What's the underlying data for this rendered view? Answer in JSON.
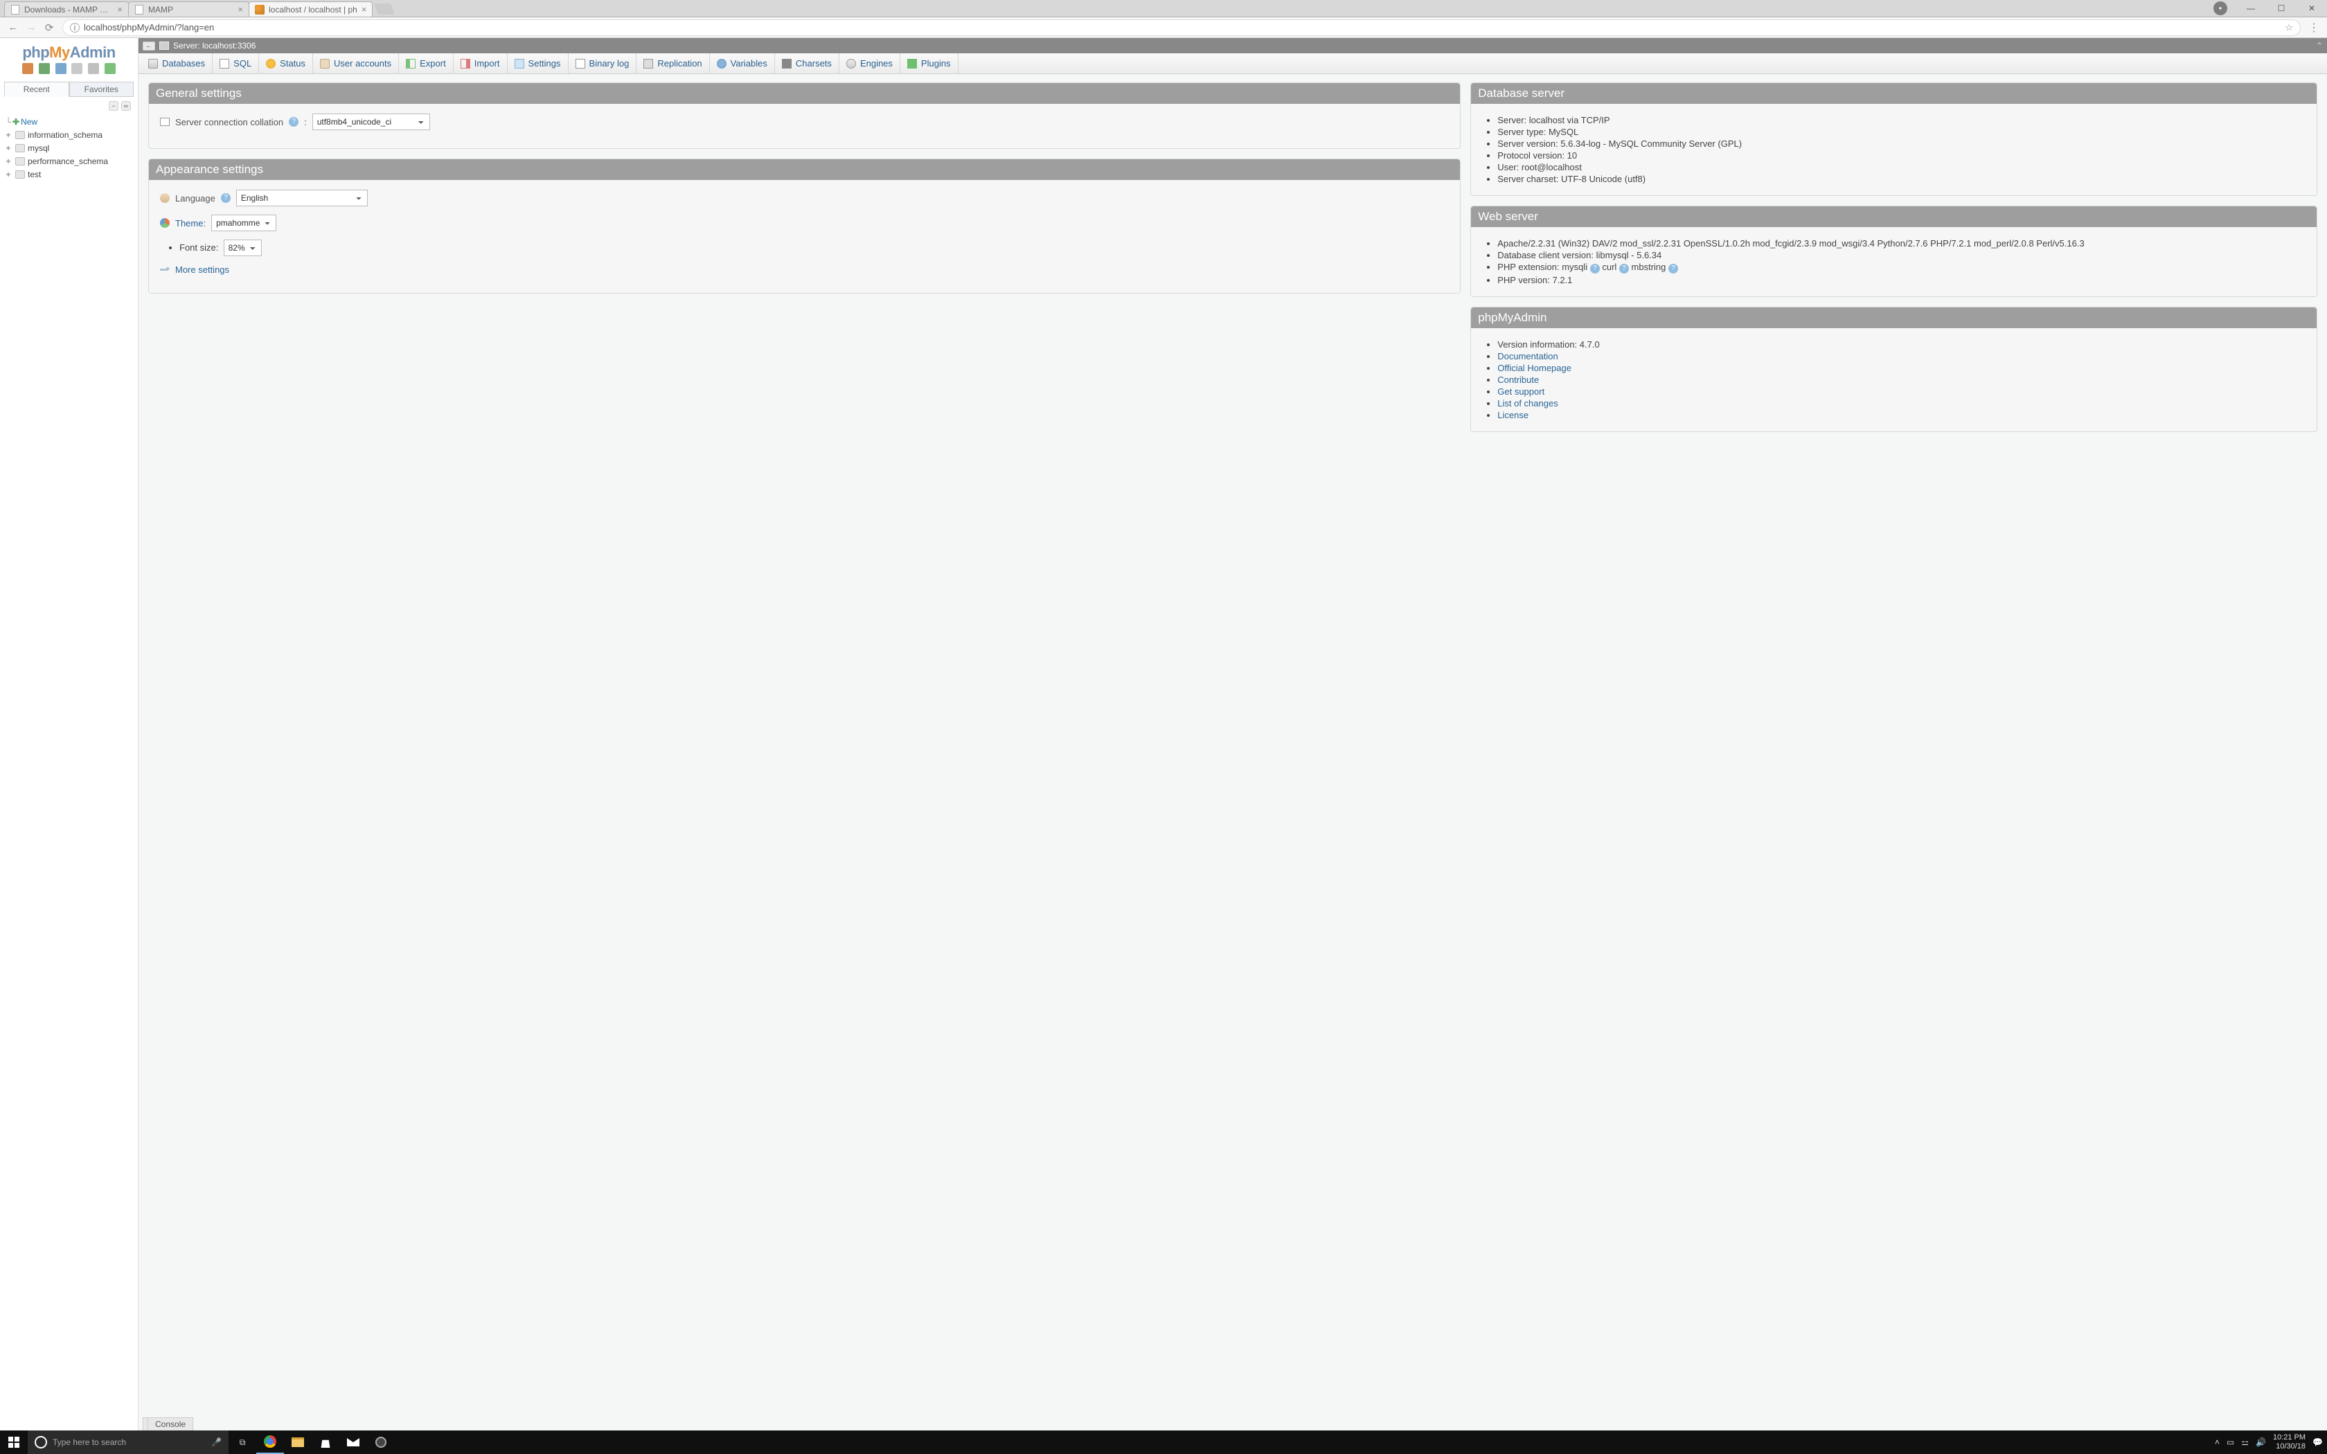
{
  "browser": {
    "tabs": [
      {
        "title": "Downloads - MAMP & M",
        "active": false
      },
      {
        "title": "MAMP",
        "active": false
      },
      {
        "title": "localhost / localhost | ph",
        "active": true
      }
    ],
    "url": "localhost/phpMyAdmin/?lang=en"
  },
  "sidebar": {
    "logo_parts": [
      "php",
      "My",
      "Admin"
    ],
    "tab_recent": "Recent",
    "tab_favorites": "Favorites",
    "collapse_minus": "−",
    "collapse_link": "∞",
    "new_label": "New",
    "databases": [
      "information_schema",
      "mysql",
      "performance_schema",
      "test"
    ]
  },
  "serverbar": {
    "label": "Server: localhost:3306"
  },
  "maintabs": [
    {
      "label": "Databases",
      "icon": "ic-databases"
    },
    {
      "label": "SQL",
      "icon": "ic-sql"
    },
    {
      "label": "Status",
      "icon": "ic-status"
    },
    {
      "label": "User accounts",
      "icon": "ic-user"
    },
    {
      "label": "Export",
      "icon": "ic-export"
    },
    {
      "label": "Import",
      "icon": "ic-import"
    },
    {
      "label": "Settings",
      "icon": "ic-settings"
    },
    {
      "label": "Binary log",
      "icon": "ic-binlog"
    },
    {
      "label": "Replication",
      "icon": "ic-repl"
    },
    {
      "label": "Variables",
      "icon": "ic-vars"
    },
    {
      "label": "Charsets",
      "icon": "ic-charsets"
    },
    {
      "label": "Engines",
      "icon": "ic-engines"
    },
    {
      "label": "Plugins",
      "icon": "ic-plugins"
    }
  ],
  "general": {
    "title": "General settings",
    "collation_label": "Server connection collation",
    "collation_value": "utf8mb4_unicode_ci"
  },
  "appearance": {
    "title": "Appearance settings",
    "language_label": "Language",
    "language_value": "English",
    "theme_label": "Theme:",
    "theme_value": "pmahomme",
    "font_label": "Font size:",
    "font_value": "82%",
    "more": "More settings"
  },
  "dbserver": {
    "title": "Database server",
    "items": [
      "Server: localhost via TCP/IP",
      "Server type: MySQL",
      "Server version: 5.6.34-log - MySQL Community Server (GPL)",
      "Protocol version: 10",
      "User: root@localhost",
      "Server charset: UTF-8 Unicode (utf8)"
    ]
  },
  "webserver": {
    "title": "Web server",
    "server_line": "Apache/2.2.31 (Win32) DAV/2 mod_ssl/2.2.31 OpenSSL/1.0.2h mod_fcgid/2.3.9 mod_wsgi/3.4 Python/2.7.6 PHP/7.2.1 mod_perl/2.0.8 Perl/v5.16.3",
    "db_client": "Database client version: libmysql - 5.6.34",
    "php_ext_label": "PHP extension:",
    "php_ext_1": "mysqli",
    "php_ext_2": "curl",
    "php_ext_3": "mbstring",
    "php_version": "PHP version: 7.2.1"
  },
  "pma": {
    "title": "phpMyAdmin",
    "version": "Version information: 4.7.0",
    "links": [
      "Documentation",
      "Official Homepage",
      "Contribute",
      "Get support",
      "List of changes",
      "License"
    ]
  },
  "console_label": "Console",
  "taskbar": {
    "search_placeholder": "Type here to search",
    "time": "10:21 PM",
    "date": "10/30/18"
  }
}
